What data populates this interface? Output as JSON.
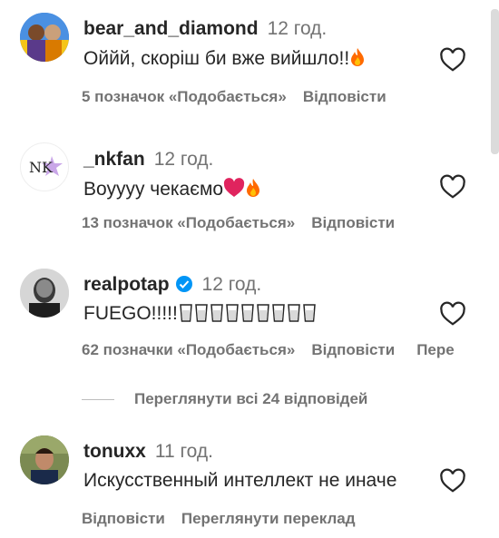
{
  "comments": [
    {
      "username": "bear_and_diamond",
      "time": "12 год.",
      "text": "Оййй, скоріш би вже вийшло!!",
      "likes": "5 позначок «Подобається»",
      "reply": "Відповісти",
      "emoji": "fire-icon"
    },
    {
      "username": "_nkfan",
      "time": "12 год.",
      "text": "Воуууу чекаємо",
      "likes": "13 позначок «Подобається»",
      "reply": "Відповісти",
      "avatar_text": "NK",
      "emoji": "heart-and-fire-icons"
    },
    {
      "username": "realpotap",
      "time": "12 год.",
      "text": "FUEGO!!!!!",
      "likes": "62 позначки «Подобається»",
      "reply": "Відповісти",
      "extra": "Пере",
      "emoji": "cup-icons",
      "verified": true
    },
    {
      "username": "tonuxx",
      "time": "11 год.",
      "text": "Искусственный интеллект не иначе",
      "reply": "Відповісти",
      "translate": "Переглянути переклад"
    }
  ],
  "view_replies": "Переглянути всі 24 відповідей",
  "colors": {
    "text": "#262626",
    "secondary": "#737373",
    "verified": "#0095f6",
    "fire": "#ff6a00",
    "heart": "#e0245e"
  }
}
